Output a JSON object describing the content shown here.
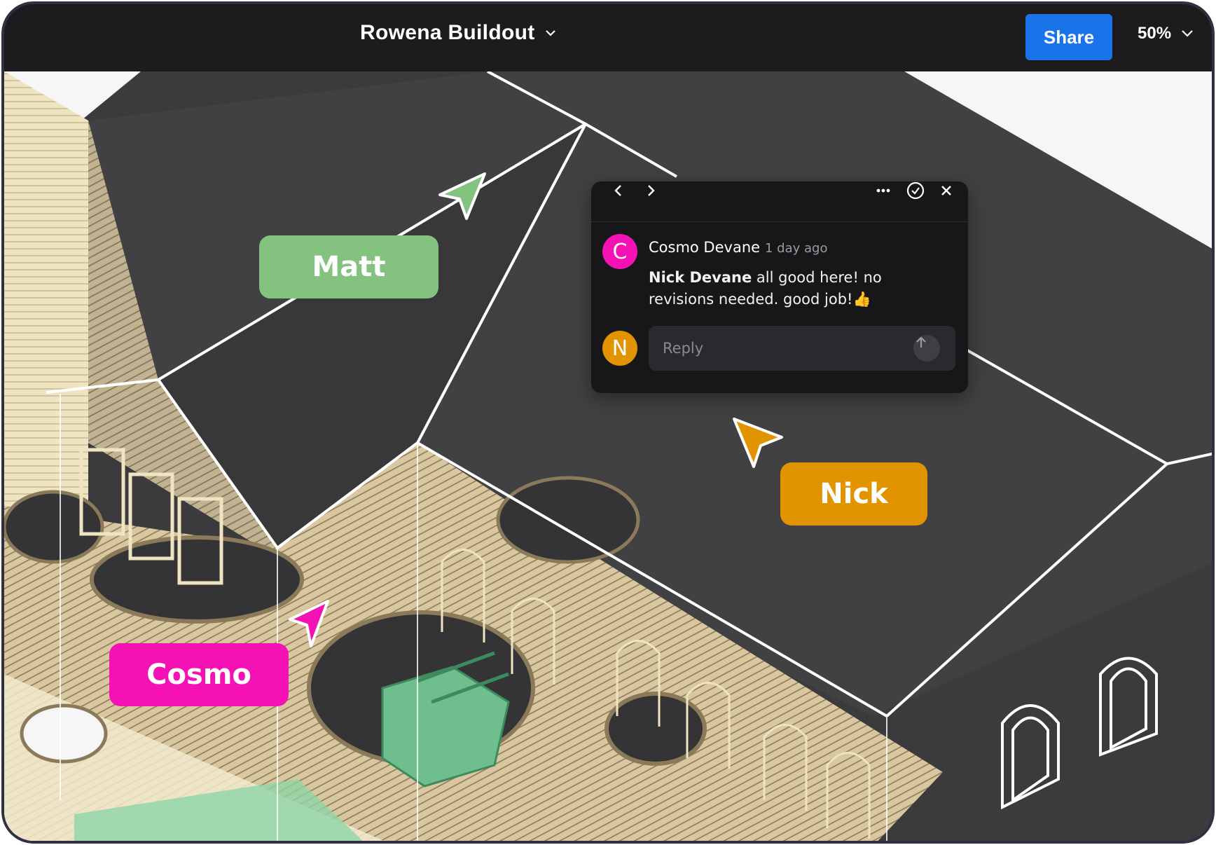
{
  "header": {
    "title": "Rowena Buildout",
    "share_label": "Share",
    "zoom": "50%"
  },
  "colors": {
    "share": "#1a73e8",
    "matt": "#83c37f",
    "nick": "#e29400",
    "cosmo": "#f512b5",
    "comment_bg": "#17171a"
  },
  "collaborators": [
    {
      "name": "Matt"
    },
    {
      "name": "Nick"
    },
    {
      "name": "Cosmo"
    }
  ],
  "comment": {
    "author": "Cosmo Devane",
    "author_initial": "C",
    "time": "1 day ago",
    "mention": "Nick Devane",
    "text": " all good here! no revisions needed. good job!👍",
    "reply_initial": "N",
    "reply_placeholder": "Reply"
  },
  "icons": {
    "prev": "chevron-left-icon",
    "next": "chevron-right-icon",
    "more": "more-icon",
    "resolve": "check-circle-icon",
    "close": "close-icon",
    "send": "arrow-up-icon"
  }
}
